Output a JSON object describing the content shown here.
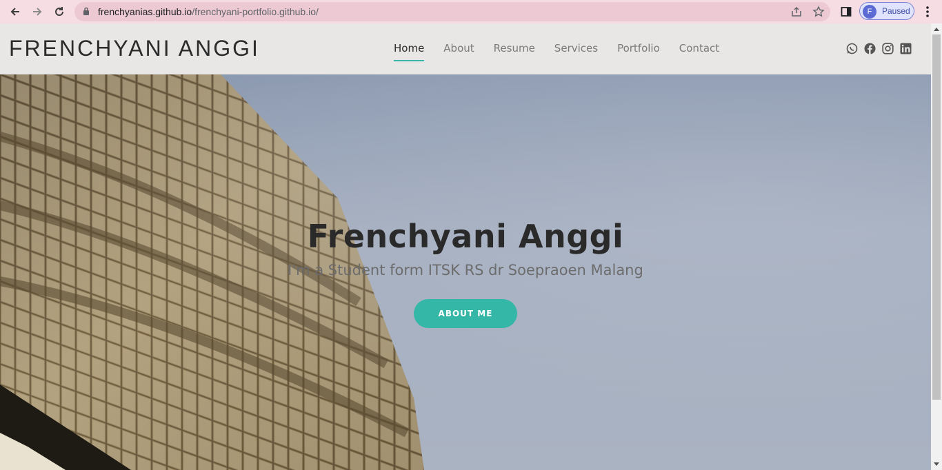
{
  "browser": {
    "url_host": "frenchyanias.github.io",
    "url_path": "/frenchyani-portfolio.github.io/",
    "profile_initial": "F",
    "profile_status": "Paused"
  },
  "header": {
    "logo": "FRENCHYANI ANGGI",
    "nav": [
      {
        "label": "Home",
        "active": true
      },
      {
        "label": "About"
      },
      {
        "label": "Resume"
      },
      {
        "label": "Services"
      },
      {
        "label": "Portfolio"
      },
      {
        "label": "Contact"
      }
    ],
    "social_icons": [
      "whatsapp-icon",
      "facebook-icon",
      "instagram-icon",
      "linkedin-icon"
    ]
  },
  "hero": {
    "title": "Frenchyani Anggi",
    "subtitle": "I'm a Student form ITSK RS dr Soepraoen Malang",
    "button_label": "ABOUT ME"
  },
  "colors": {
    "accent": "#34b7a7",
    "chrome": "#f6dde4",
    "header_bg": "#e9e7e5"
  }
}
